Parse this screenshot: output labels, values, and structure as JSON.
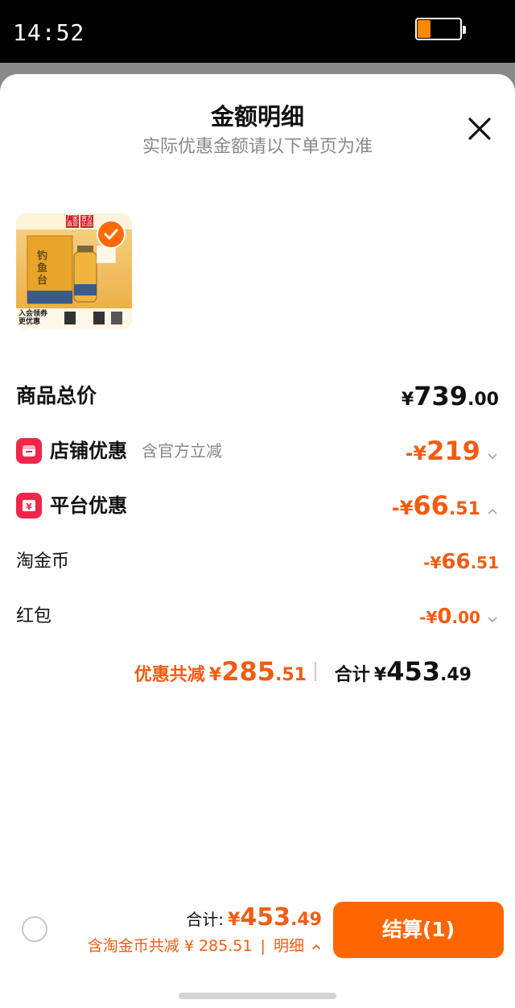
{
  "status_bar": {
    "time": "14:52",
    "battery_level": 0.3,
    "battery_color": "#ff8a00"
  },
  "sheet": {
    "title": "金额明细",
    "subtitle": "实际优惠金额请以下单页为准",
    "close_icon": "close-icon"
  },
  "product": {
    "brand_text": "钓鱼台",
    "badge_top": "厂家直营",
    "badge_top2": "官方正品",
    "promo_text": "入会领券 更优惠",
    "check_icon": "check-circle-icon"
  },
  "breakdown": {
    "total_label": "商品总价",
    "total_currency": "¥",
    "total_int": "739",
    "total_dec": ".00",
    "shop_label": "店铺优惠",
    "shop_sub": "含官方立减",
    "shop_prefix": "-¥",
    "shop_int": "219",
    "shop_dec": "",
    "platform_label": "平台优惠",
    "platform_prefix": "-¥",
    "platform_int": "66",
    "platform_dec": ".51",
    "coin_label": "淘金币",
    "coin_prefix": "-¥",
    "coin_int": "66",
    "coin_dec": ".51",
    "redpacket_label": "红包",
    "redpacket_prefix": "-¥",
    "redpacket_int": "0",
    "redpacket_dec": ".00"
  },
  "summary": {
    "discount_label": "优惠共减",
    "discount_currency": "¥",
    "discount_int": "285",
    "discount_dec": ".51",
    "total_label": "合计",
    "total_currency": "¥",
    "total_int": "453",
    "total_dec": ".49"
  },
  "bottom_bar": {
    "total_label": "合计:",
    "total_currency": "¥",
    "total_int": "453",
    "total_dec": ".49",
    "coin_note": "含淘金币共减 ¥ 285.51",
    "detail_label": "明细",
    "checkout_label": "结算(1)"
  },
  "colors": {
    "accent": "#f25c12",
    "button": "#ff6600",
    "icon_red": "#f2264a"
  }
}
